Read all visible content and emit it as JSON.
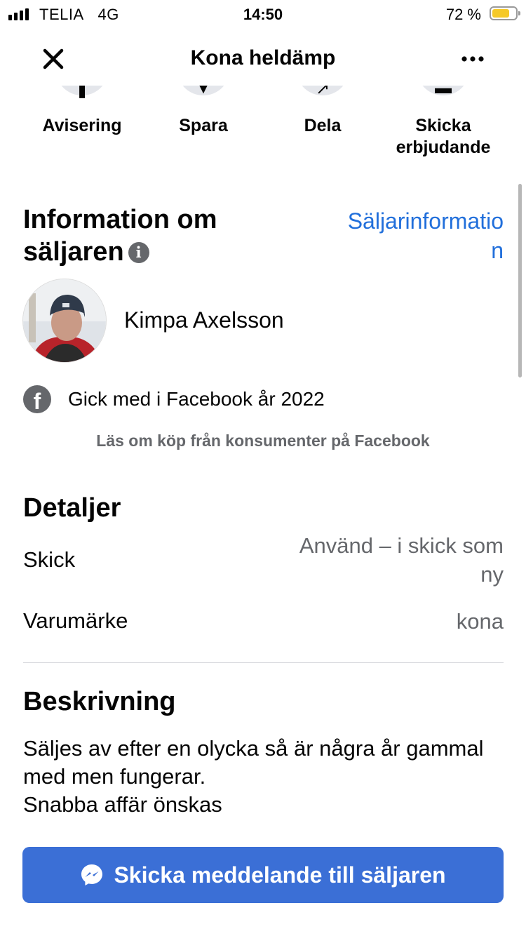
{
  "status_bar": {
    "carrier": "TELIA",
    "network": "4G",
    "time": "14:50",
    "battery_percent": "72 %",
    "battery_level": 0.72,
    "battery_color": "#f5c928"
  },
  "header": {
    "title": "Kona heldämp",
    "close_icon": "close-icon",
    "more_icon": "more-options-icon"
  },
  "actions": [
    {
      "label": "Avisering",
      "icon": "bell-icon"
    },
    {
      "label": "Spara",
      "icon": "bookmark-icon"
    },
    {
      "label": "Dela",
      "icon": "share-icon"
    },
    {
      "label": "Skicka erbjudande",
      "icon": "offer-icon"
    }
  ],
  "seller": {
    "section_title": "Information om säljaren",
    "info_icon": "info-icon",
    "seller_info_link": "Säljarinformation",
    "name": "Kimpa Axelsson",
    "joined": "Gick med i Facebook år 2022",
    "read_more": "Läs om köp från konsumenter på Facebook"
  },
  "details": {
    "title": "Detaljer",
    "rows": [
      {
        "key": "Skick",
        "value": "Använd – i skick som ny"
      },
      {
        "key": "Varumärke",
        "value": "kona"
      }
    ]
  },
  "description": {
    "title": "Beskrivning",
    "lines": [
      "Säljes av efter en olycka så är några år gammal med men fungerar.",
      "Snabba affär önskas"
    ]
  },
  "cta": {
    "label": "Skicka meddelande till säljaren",
    "icon": "messenger-icon",
    "color": "#3b6fd6"
  },
  "colors": {
    "link": "#216fdb",
    "secondary_text": "#65676b"
  }
}
